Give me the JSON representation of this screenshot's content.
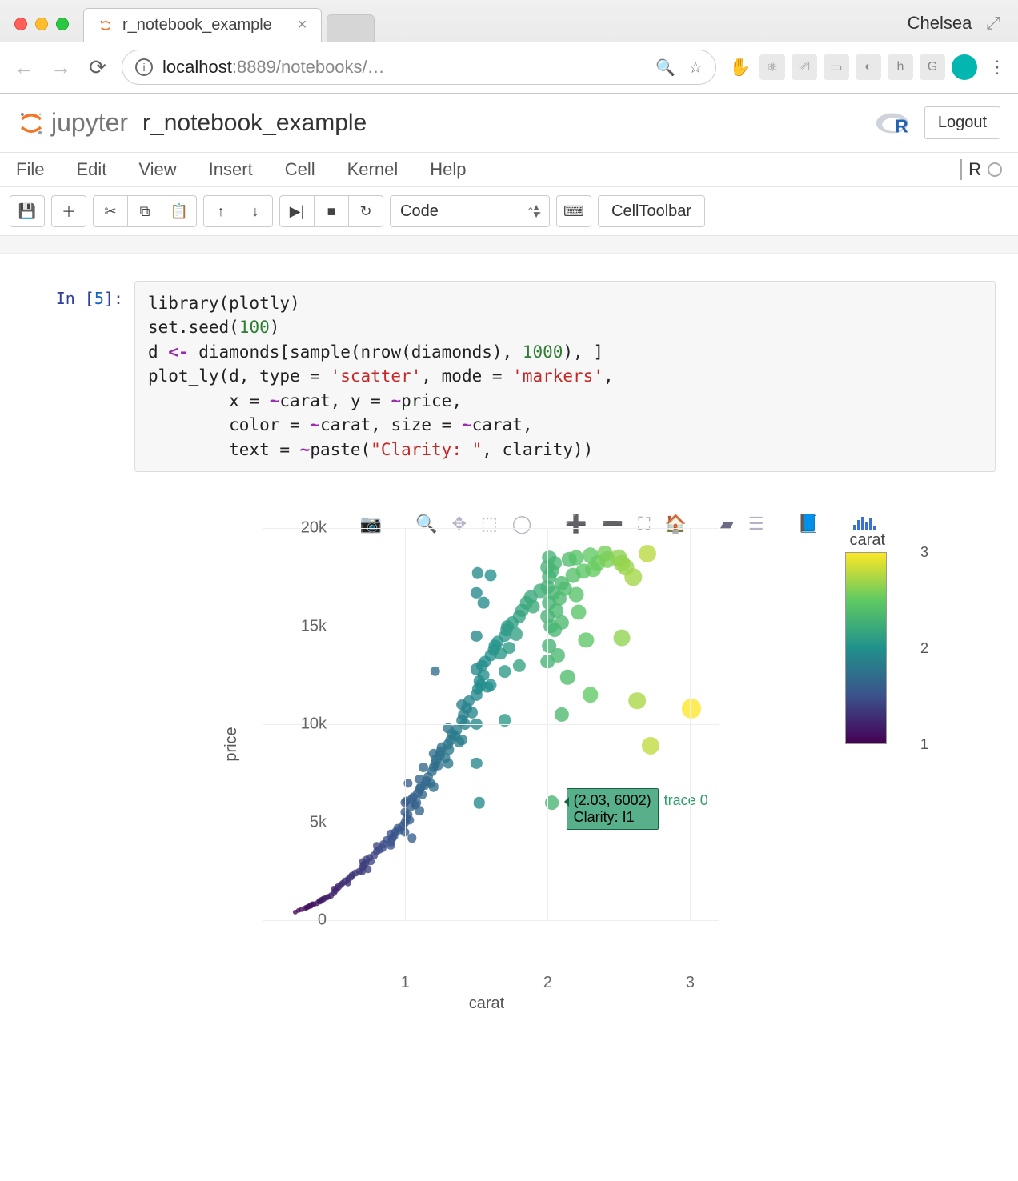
{
  "browser": {
    "tab_title": "r_notebook_example",
    "profile_name": "Chelsea",
    "url_host": "localhost",
    "url_port": ":8889",
    "url_path": "/notebooks/…",
    "tab_close": "×"
  },
  "jupyter": {
    "brand": "jupyter",
    "notebook_name": "r_notebook_example",
    "logout": "Logout",
    "kernel_name": "R"
  },
  "menu": {
    "file": "File",
    "edit": "Edit",
    "view": "View",
    "insert": "Insert",
    "cell": "Cell",
    "kernel": "Kernel",
    "help": "Help"
  },
  "toolbar": {
    "cell_type": "Code",
    "cell_toolbar": "CellToolbar"
  },
  "cell": {
    "prompt_prefix": "In [",
    "prompt_num": "5",
    "prompt_suffix": "]:",
    "code_plain": "library(plotly)\nset.seed(100)\nd <- diamonds[sample(nrow(diamonds), 1000), ]\nplot_ly(d, type = 'scatter', mode = 'markers',\n        x = ~carat, y = ~price,\n        color = ~carat, size = ~carat,\n        text = ~paste(\"Clarity: \", clarity))"
  },
  "tooltip": {
    "line1": "(2.03, 6002)",
    "line2": "Clarity:  I1",
    "trace": "trace 0"
  },
  "chart_data": {
    "type": "scatter",
    "title": "",
    "xlabel": "carat",
    "ylabel": "price",
    "xlim": [
      0,
      3.2
    ],
    "ylim": [
      0,
      20000
    ],
    "xticks": [
      1,
      2,
      3
    ],
    "yticks": [
      0,
      5000,
      10000,
      15000,
      20000
    ],
    "ytick_labels": [
      "0",
      "5k",
      "10k",
      "15k",
      "20k"
    ],
    "color_scale": "viridis",
    "color_variable": "carat",
    "size_variable": "carat",
    "colorbar": {
      "title": "carat",
      "ticks": [
        1,
        2,
        3
      ]
    },
    "hover_point": {
      "x": 2.03,
      "y": 6002,
      "text": "Clarity:  I1",
      "trace": "trace 0"
    },
    "series": [
      {
        "name": "trace 0",
        "points": [
          {
            "x": 0.23,
            "y": 400
          },
          {
            "x": 0.25,
            "y": 500
          },
          {
            "x": 0.27,
            "y": 550
          },
          {
            "x": 0.3,
            "y": 600
          },
          {
            "x": 0.31,
            "y": 650
          },
          {
            "x": 0.32,
            "y": 700
          },
          {
            "x": 0.33,
            "y": 720
          },
          {
            "x": 0.34,
            "y": 750
          },
          {
            "x": 0.35,
            "y": 800
          },
          {
            "x": 0.36,
            "y": 820
          },
          {
            "x": 0.38,
            "y": 870
          },
          {
            "x": 0.4,
            "y": 950
          },
          {
            "x": 0.4,
            "y": 1000
          },
          {
            "x": 0.41,
            "y": 1020
          },
          {
            "x": 0.42,
            "y": 1050
          },
          {
            "x": 0.43,
            "y": 1100
          },
          {
            "x": 0.45,
            "y": 1150
          },
          {
            "x": 0.46,
            "y": 1200
          },
          {
            "x": 0.48,
            "y": 1250
          },
          {
            "x": 0.5,
            "y": 1400
          },
          {
            "x": 0.5,
            "y": 1600
          },
          {
            "x": 0.51,
            "y": 1500
          },
          {
            "x": 0.52,
            "y": 1650
          },
          {
            "x": 0.53,
            "y": 1700
          },
          {
            "x": 0.55,
            "y": 1800
          },
          {
            "x": 0.56,
            "y": 1900
          },
          {
            "x": 0.58,
            "y": 2000
          },
          {
            "x": 0.6,
            "y": 2100
          },
          {
            "x": 0.6,
            "y": 1900
          },
          {
            "x": 0.62,
            "y": 2200
          },
          {
            "x": 0.63,
            "y": 2300
          },
          {
            "x": 0.65,
            "y": 2400
          },
          {
            "x": 0.68,
            "y": 2500
          },
          {
            "x": 0.7,
            "y": 2700
          },
          {
            "x": 0.7,
            "y": 3000
          },
          {
            "x": 0.7,
            "y": 2500
          },
          {
            "x": 0.71,
            "y": 2800
          },
          {
            "x": 0.72,
            "y": 2900
          },
          {
            "x": 0.73,
            "y": 3100
          },
          {
            "x": 0.74,
            "y": 2600
          },
          {
            "x": 0.75,
            "y": 3200
          },
          {
            "x": 0.76,
            "y": 3000
          },
          {
            "x": 0.78,
            "y": 3300
          },
          {
            "x": 0.8,
            "y": 3500
          },
          {
            "x": 0.8,
            "y": 3800
          },
          {
            "x": 0.82,
            "y": 3600
          },
          {
            "x": 0.84,
            "y": 3700
          },
          {
            "x": 0.85,
            "y": 3900
          },
          {
            "x": 0.87,
            "y": 4100
          },
          {
            "x": 0.9,
            "y": 4000
          },
          {
            "x": 0.9,
            "y": 4400
          },
          {
            "x": 0.9,
            "y": 3800
          },
          {
            "x": 0.91,
            "y": 4200
          },
          {
            "x": 0.92,
            "y": 4300
          },
          {
            "x": 0.93,
            "y": 4500
          },
          {
            "x": 0.95,
            "y": 4700
          },
          {
            "x": 0.96,
            "y": 4600
          },
          {
            "x": 0.98,
            "y": 4800
          },
          {
            "x": 1.0,
            "y": 5000
          },
          {
            "x": 1.0,
            "y": 5500
          },
          {
            "x": 1.0,
            "y": 4500
          },
          {
            "x": 1.0,
            "y": 6000
          },
          {
            "x": 1.01,
            "y": 5200
          },
          {
            "x": 1.01,
            "y": 6100
          },
          {
            "x": 1.02,
            "y": 5400
          },
          {
            "x": 1.02,
            "y": 7000
          },
          {
            "x": 1.03,
            "y": 5100
          },
          {
            "x": 1.04,
            "y": 5800
          },
          {
            "x": 1.05,
            "y": 6200
          },
          {
            "x": 1.05,
            "y": 4200
          },
          {
            "x": 1.06,
            "y": 6300
          },
          {
            "x": 1.07,
            "y": 5900
          },
          {
            "x": 1.08,
            "y": 6000
          },
          {
            "x": 1.09,
            "y": 6500
          },
          {
            "x": 1.1,
            "y": 6700
          },
          {
            "x": 1.1,
            "y": 5600
          },
          {
            "x": 1.1,
            "y": 7200
          },
          {
            "x": 1.11,
            "y": 6800
          },
          {
            "x": 1.12,
            "y": 6400
          },
          {
            "x": 1.13,
            "y": 7800
          },
          {
            "x": 1.14,
            "y": 6900
          },
          {
            "x": 1.15,
            "y": 7100
          },
          {
            "x": 1.16,
            "y": 7300
          },
          {
            "x": 1.18,
            "y": 7000
          },
          {
            "x": 1.19,
            "y": 7600
          },
          {
            "x": 1.2,
            "y": 7800
          },
          {
            "x": 1.2,
            "y": 6800
          },
          {
            "x": 1.2,
            "y": 8500
          },
          {
            "x": 1.21,
            "y": 12700
          },
          {
            "x": 1.21,
            "y": 8000
          },
          {
            "x": 1.22,
            "y": 8200
          },
          {
            "x": 1.23,
            "y": 7900
          },
          {
            "x": 1.24,
            "y": 8400
          },
          {
            "x": 1.25,
            "y": 8600
          },
          {
            "x": 1.26,
            "y": 8800
          },
          {
            "x": 1.28,
            "y": 8300
          },
          {
            "x": 1.3,
            "y": 9000
          },
          {
            "x": 1.3,
            "y": 8000
          },
          {
            "x": 1.3,
            "y": 9800
          },
          {
            "x": 1.31,
            "y": 8700
          },
          {
            "x": 1.32,
            "y": 9200
          },
          {
            "x": 1.33,
            "y": 9500
          },
          {
            "x": 1.35,
            "y": 9400
          },
          {
            "x": 1.36,
            "y": 9700
          },
          {
            "x": 1.38,
            "y": 9100
          },
          {
            "x": 1.4,
            "y": 10200
          },
          {
            "x": 1.4,
            "y": 9200
          },
          {
            "x": 1.4,
            "y": 11000
          },
          {
            "x": 1.41,
            "y": 10500
          },
          {
            "x": 1.42,
            "y": 10000
          },
          {
            "x": 1.43,
            "y": 10800
          },
          {
            "x": 1.45,
            "y": 11200
          },
          {
            "x": 1.47,
            "y": 10600
          },
          {
            "x": 1.5,
            "y": 11500
          },
          {
            "x": 1.5,
            "y": 10000
          },
          {
            "x": 1.5,
            "y": 12800
          },
          {
            "x": 1.5,
            "y": 8000
          },
          {
            "x": 1.5,
            "y": 16700
          },
          {
            "x": 1.5,
            "y": 14500
          },
          {
            "x": 1.51,
            "y": 11800
          },
          {
            "x": 1.51,
            "y": 17700
          },
          {
            "x": 1.52,
            "y": 12200
          },
          {
            "x": 1.52,
            "y": 6000
          },
          {
            "x": 1.53,
            "y": 12000
          },
          {
            "x": 1.54,
            "y": 13000
          },
          {
            "x": 1.55,
            "y": 12500
          },
          {
            "x": 1.55,
            "y": 16200
          },
          {
            "x": 1.56,
            "y": 13200
          },
          {
            "x": 1.58,
            "y": 11900
          },
          {
            "x": 1.6,
            "y": 13500
          },
          {
            "x": 1.6,
            "y": 12000
          },
          {
            "x": 1.6,
            "y": 17600
          },
          {
            "x": 1.62,
            "y": 13800
          },
          {
            "x": 1.63,
            "y": 14000
          },
          {
            "x": 1.65,
            "y": 14200
          },
          {
            "x": 1.67,
            "y": 13600
          },
          {
            "x": 1.7,
            "y": 14500
          },
          {
            "x": 1.7,
            "y": 12700
          },
          {
            "x": 1.7,
            "y": 10200
          },
          {
            "x": 1.71,
            "y": 14800
          },
          {
            "x": 1.72,
            "y": 15000
          },
          {
            "x": 1.73,
            "y": 13900
          },
          {
            "x": 1.75,
            "y": 15200
          },
          {
            "x": 1.78,
            "y": 14600
          },
          {
            "x": 1.8,
            "y": 15500
          },
          {
            "x": 1.8,
            "y": 13000
          },
          {
            "x": 1.82,
            "y": 15800
          },
          {
            "x": 1.85,
            "y": 16200
          },
          {
            "x": 1.88,
            "y": 16500
          },
          {
            "x": 1.9,
            "y": 16000
          },
          {
            "x": 1.95,
            "y": 16800
          },
          {
            "x": 2.0,
            "y": 17000
          },
          {
            "x": 2.0,
            "y": 15500
          },
          {
            "x": 2.0,
            "y": 18000
          },
          {
            "x": 2.0,
            "y": 13200
          },
          {
            "x": 2.01,
            "y": 16200
          },
          {
            "x": 2.01,
            "y": 17500
          },
          {
            "x": 2.01,
            "y": 14000
          },
          {
            "x": 2.01,
            "y": 18500
          },
          {
            "x": 2.02,
            "y": 15000
          },
          {
            "x": 2.03,
            "y": 6002
          },
          {
            "x": 2.03,
            "y": 17800
          },
          {
            "x": 2.04,
            "y": 16700
          },
          {
            "x": 2.05,
            "y": 14800
          },
          {
            "x": 2.05,
            "y": 18200
          },
          {
            "x": 2.06,
            "y": 15800
          },
          {
            "x": 2.07,
            "y": 13500
          },
          {
            "x": 2.08,
            "y": 16400
          },
          {
            "x": 2.1,
            "y": 17200
          },
          {
            "x": 2.1,
            "y": 15200
          },
          {
            "x": 2.1,
            "y": 10500
          },
          {
            "x": 2.12,
            "y": 16900
          },
          {
            "x": 2.14,
            "y": 12400
          },
          {
            "x": 2.15,
            "y": 18400
          },
          {
            "x": 2.18,
            "y": 17600
          },
          {
            "x": 2.2,
            "y": 16600
          },
          {
            "x": 2.2,
            "y": 18500
          },
          {
            "x": 2.22,
            "y": 15700
          },
          {
            "x": 2.25,
            "y": 17800
          },
          {
            "x": 2.27,
            "y": 14300
          },
          {
            "x": 2.3,
            "y": 18600
          },
          {
            "x": 2.3,
            "y": 11500
          },
          {
            "x": 2.32,
            "y": 17900
          },
          {
            "x": 2.35,
            "y": 18200
          },
          {
            "x": 2.4,
            "y": 18700
          },
          {
            "x": 2.42,
            "y": 18400
          },
          {
            "x": 2.5,
            "y": 18500
          },
          {
            "x": 2.52,
            "y": 14400
          },
          {
            "x": 2.52,
            "y": 18200
          },
          {
            "x": 2.55,
            "y": 18000
          },
          {
            "x": 2.6,
            "y": 17500
          },
          {
            "x": 2.63,
            "y": 11200
          },
          {
            "x": 2.7,
            "y": 18700
          },
          {
            "x": 2.72,
            "y": 8900
          },
          {
            "x": 3.01,
            "y": 10800
          }
        ]
      }
    ]
  }
}
